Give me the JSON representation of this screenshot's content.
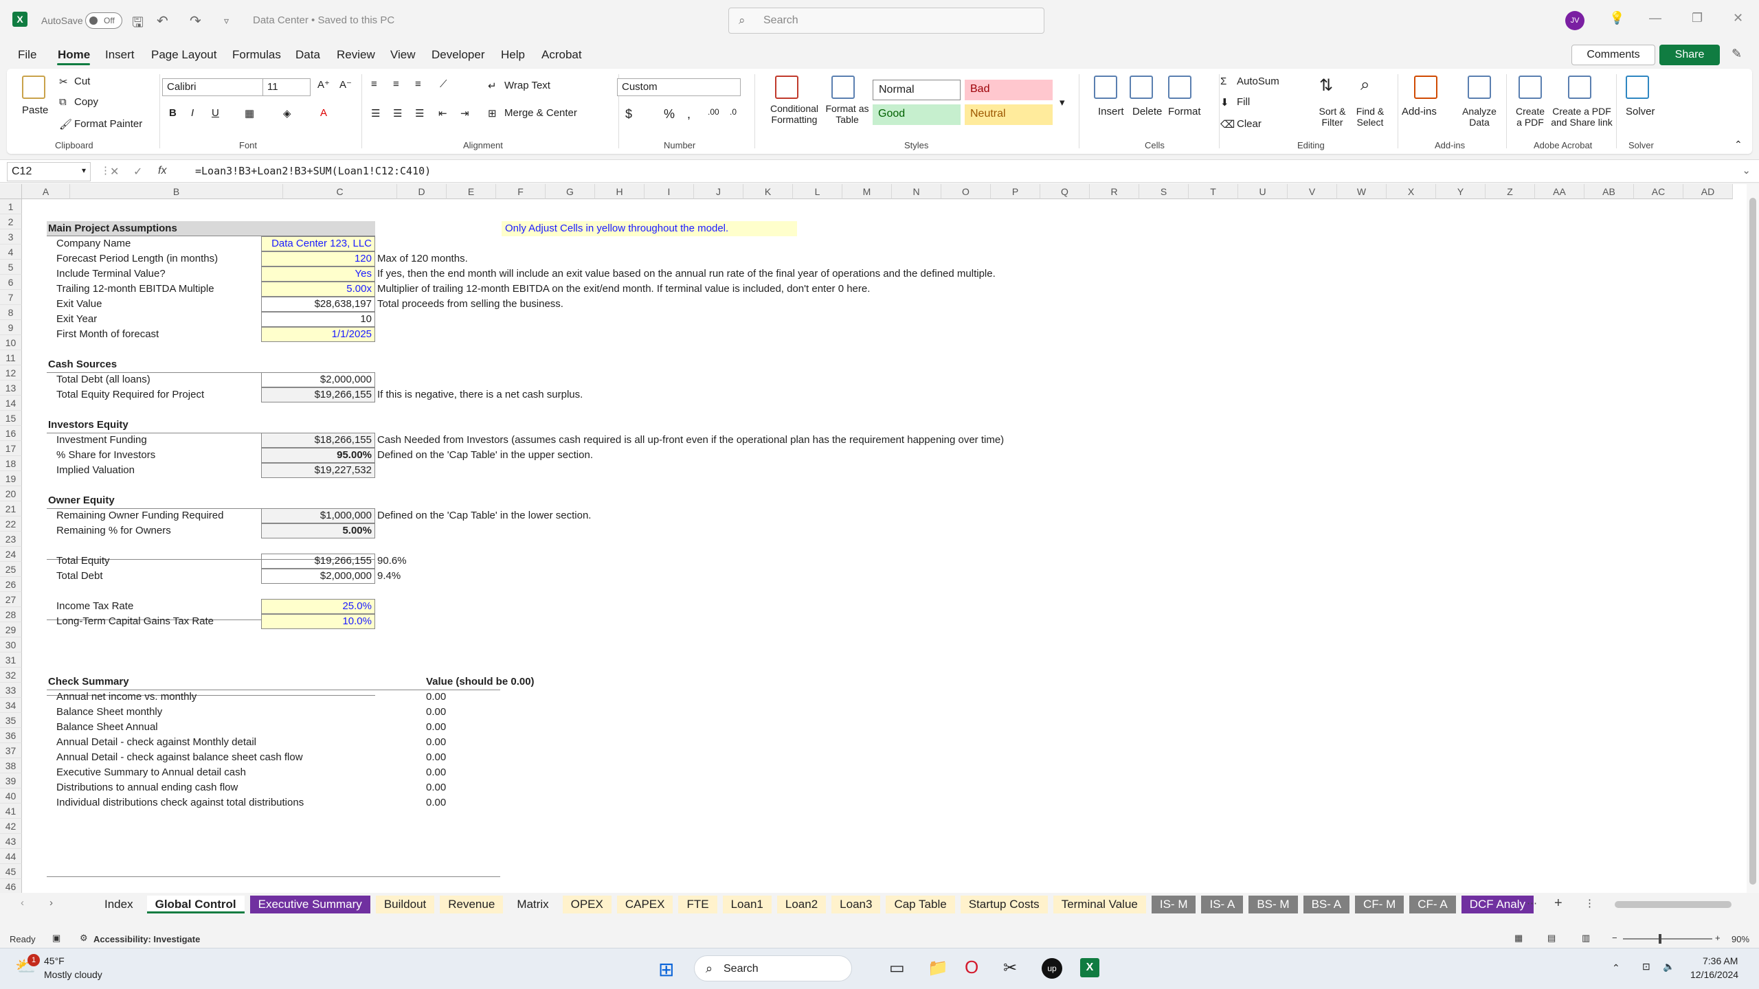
{
  "titlebar": {
    "autosave_label": "AutoSave",
    "autosave_state": "Off",
    "doc_title": "Data Center • Saved to this PC",
    "search_placeholder": "Search",
    "avatar_initials": "JV"
  },
  "menu": {
    "tabs": [
      "File",
      "Home",
      "Insert",
      "Page Layout",
      "Formulas",
      "Data",
      "Review",
      "View",
      "Developer",
      "Help",
      "Acrobat"
    ],
    "active": "Home",
    "comments_label": "Comments",
    "share_label": "Share"
  },
  "ribbon": {
    "clipboard": {
      "paste": "Paste",
      "cut": "Cut",
      "copy": "Copy",
      "format_painter": "Format Painter",
      "group": "Clipboard"
    },
    "font": {
      "name": "Calibri",
      "size": "11",
      "group": "Font"
    },
    "alignment": {
      "wrap_text": "Wrap Text",
      "merge_center": "Merge & Center",
      "group": "Alignment"
    },
    "number": {
      "format": "Custom",
      "group": "Number"
    },
    "styles": {
      "conditional_formatting": "Conditional Formatting",
      "format_as_table": "Format as Table",
      "normal": "Normal",
      "bad": "Bad",
      "good": "Good",
      "neutral": "Neutral",
      "group": "Styles"
    },
    "cells": {
      "insert": "Insert",
      "delete": "Delete",
      "format": "Format",
      "group": "Cells"
    },
    "editing": {
      "autosum": "AutoSum",
      "fill": "Fill",
      "clear": "Clear",
      "sort_filter": "Sort & Filter",
      "find_select": "Find & Select",
      "group": "Editing"
    },
    "addins": {
      "addins": "Add-ins",
      "analyze_data": "Analyze Data",
      "group": "Add-ins"
    },
    "acrobat": {
      "create_pdf": "Create a PDF",
      "create_share": "Create a PDF and Share link",
      "group": "Adobe Acrobat"
    },
    "solver": {
      "solver": "Solver",
      "group": "Solver"
    },
    "colors": {
      "bad_bg": "#ffc7ce",
      "good_bg": "#c6efce",
      "neutral_bg": "#ffeb9c"
    }
  },
  "formula_bar": {
    "name_box": "C12",
    "formula": "=Loan3!B3+Loan2!B3+SUM(Loan1!C12:C410)"
  },
  "columns": [
    "A",
    "B",
    "C",
    "D",
    "E",
    "F",
    "G",
    "H",
    "I",
    "J",
    "K",
    "L",
    "M",
    "N",
    "O",
    "P",
    "Q",
    "R",
    "S",
    "T",
    "U",
    "V",
    "W",
    "X",
    "Y",
    "Z",
    "AA",
    "AB",
    "AC",
    "AD"
  ],
  "rows": [
    "1",
    "2",
    "3",
    "4",
    "5",
    "6",
    "7",
    "8",
    "9",
    "10",
    "11",
    "12",
    "13",
    "14",
    "15",
    "16",
    "17",
    "18",
    "19",
    "20",
    "21",
    "22",
    "23",
    "24",
    "25",
    "26",
    "27",
    "28",
    "29",
    "30",
    "31",
    "32",
    "33",
    "34",
    "35",
    "36",
    "37",
    "38",
    "39",
    "40",
    "41",
    "42",
    "43",
    "44",
    "45",
    "46"
  ],
  "sheet": {
    "instruction": "Only Adjust Cells in yellow throughout the model.",
    "main": {
      "header": "Main Project Assumptions",
      "company_name_label": "Company Name",
      "company_name": "Data Center 123, LLC",
      "forecast_label": "Forecast Period Length (in months)",
      "forecast": "120",
      "forecast_note": "Max of 120 months.",
      "terminal_label": "Include Terminal Value?",
      "terminal": "Yes",
      "terminal_note": "If yes, then the end month will include an exit value based on the annual run rate of the final year of operations and the defined multiple.",
      "multiple_label": "Trailing 12-month EBITDA Multiple",
      "multiple": "5.00x",
      "multiple_note": "Multiplier of trailing 12-month EBITDA on the exit/end month. If terminal value is included, don't enter 0 here.",
      "exit_value_label": "Exit Value",
      "exit_value": "$28,638,197",
      "exit_value_note": "Total proceeds from selling the business.",
      "exit_year_label": "Exit Year",
      "exit_year": "10",
      "first_month_label": "First Month of forecast",
      "first_month": "1/1/2025"
    },
    "cash": {
      "header": "Cash Sources",
      "debt_label": "Total Debt (all loans)",
      "debt": "$2,000,000",
      "equity_label": "Total Equity Required for Project",
      "equity": "$19,266,155",
      "equity_note": "If this is negative, there is a net cash surplus."
    },
    "investors": {
      "header": "Investors Equity",
      "funding_label": "Investment Funding",
      "funding": "$18,266,155",
      "funding_note": "Cash Needed from Investors (assumes cash required is all up-front even if the operational plan has the requirement happening over time)",
      "share_label": "% Share for Investors",
      "share": "95.00%",
      "share_note": "Defined on the 'Cap Table' in the upper section.",
      "valuation_label": "Implied Valuation",
      "valuation": "$19,227,532"
    },
    "owner": {
      "header": "Owner Equity",
      "remaining_label": "Remaining Owner Funding Required",
      "remaining": "$1,000,000",
      "remaining_note": "Defined on the 'Cap Table' in the lower section.",
      "pct_label": "Remaining % for Owners",
      "pct": "5.00%"
    },
    "totals": {
      "equity_label": "Total Equity",
      "equity": "$19,266,155",
      "equity_pct": "90.6%",
      "debt_label": "Total Debt",
      "debt": "$2,000,000",
      "debt_pct": "9.4%"
    },
    "tax": {
      "income_label": "Income Tax Rate",
      "income": "25.0%",
      "ltcg_label": "Long-Term Capital Gains Tax Rate",
      "ltcg": "10.0%"
    },
    "checks": {
      "header": "Check Summary",
      "value_header": "Value (should be 0.00)",
      "items": [
        {
          "label": "Annual net income vs. monthly",
          "value": "0.00"
        },
        {
          "label": "Balance Sheet monthly",
          "value": "0.00"
        },
        {
          "label": "Balance Sheet Annual",
          "value": "0.00"
        },
        {
          "label": "Annual Detail - check against Monthly detail",
          "value": "0.00"
        },
        {
          "label": "Annual Detail - check against balance sheet cash flow",
          "value": "0.00"
        },
        {
          "label": "Executive Summary to Annual detail cash",
          "value": "0.00"
        },
        {
          "label": "Distributions to annual ending cash flow",
          "value": "0.00"
        },
        {
          "label": "Individual distributions check against total distributions",
          "value": "0.00"
        }
      ]
    }
  },
  "sheet_tabs": [
    {
      "label": "Index",
      "style": "plain"
    },
    {
      "label": "Global Control",
      "style": "active"
    },
    {
      "label": "Executive Summary",
      "style": "purple"
    },
    {
      "label": "Buildout",
      "style": "yellow"
    },
    {
      "label": "Revenue",
      "style": "yellow"
    },
    {
      "label": "Matrix",
      "style": "plain"
    },
    {
      "label": "OPEX",
      "style": "yellow"
    },
    {
      "label": "CAPEX",
      "style": "yellow"
    },
    {
      "label": "FTE",
      "style": "yellow"
    },
    {
      "label": "Loan1",
      "style": "yellow"
    },
    {
      "label": "Loan2",
      "style": "yellow"
    },
    {
      "label": "Loan3",
      "style": "yellow"
    },
    {
      "label": "Cap Table",
      "style": "yellow"
    },
    {
      "label": "Startup Costs",
      "style": "yellow"
    },
    {
      "label": "Terminal Value",
      "style": "yellow"
    },
    {
      "label": "IS- M",
      "style": "grey"
    },
    {
      "label": "IS- A",
      "style": "grey"
    },
    {
      "label": "BS- M",
      "style": "grey"
    },
    {
      "label": "BS- A",
      "style": "grey"
    },
    {
      "label": "CF- M",
      "style": "grey"
    },
    {
      "label": "CF- A",
      "style": "grey"
    },
    {
      "label": "DCF Analy",
      "style": "purple"
    }
  ],
  "status": {
    "ready": "Ready",
    "accessibility": "Accessibility: Investigate",
    "zoom": "90%"
  },
  "taskbar": {
    "temp": "45°F",
    "weather": "Mostly cloudy",
    "search": "Search",
    "time": "7:36 AM",
    "date": "12/16/2024",
    "badge": "1"
  }
}
